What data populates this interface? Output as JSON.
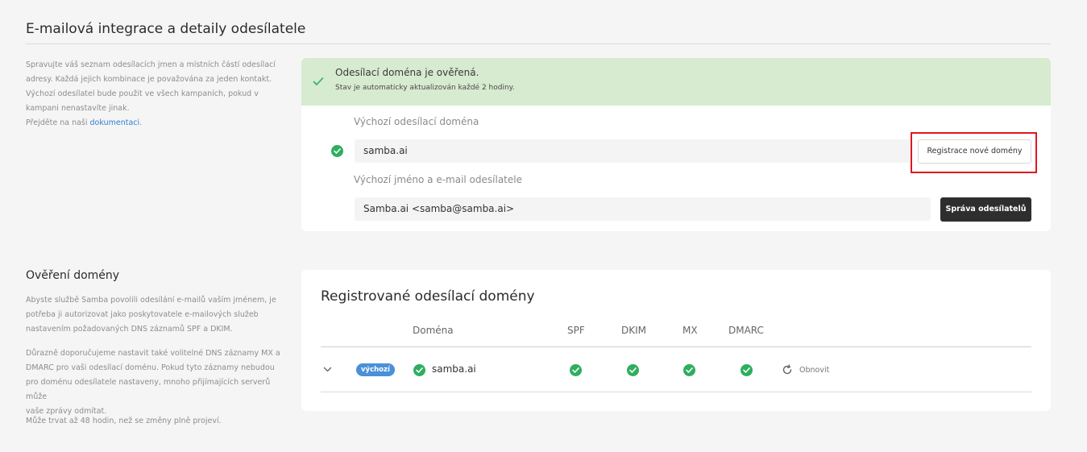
{
  "integration": {
    "title": "E-mailová integrace a detaily odesílatele",
    "description_lines": [
      "Spravujte váš seznam odesílacích jmen a místních částí odesílací",
      "adresy. Každá jejich kombinace je považována za jeden kontakt.",
      "Výchozí odesílatel bude použit ve všech kampaních, pokud v",
      "kampani nenastavíte jinak."
    ],
    "docs_prefix": "Přejděte na naši ",
    "docs_link": "dokumentaci",
    "docs_suffix": ".",
    "banner": {
      "title": "Odesílací doména je ověřená.",
      "subtitle": "Stav je automaticky aktualizován každé 2 hodiny."
    },
    "default_domain_label": "Výchozí odesílací doména",
    "default_domain_value": "samba.ai",
    "register_button": "Registrace nové domény",
    "default_sender_label": "Výchozí jméno a e-mail odesílatele",
    "default_sender_value": "Samba.ai <samba@samba.ai>",
    "manage_senders_button": "Správa odesílatelů"
  },
  "verification": {
    "title": "Ověření domény",
    "paragraph1_lines": [
      "Abyste službě Samba povolili odesílání e-mailů vaším jménem, je",
      "potřeba ji autorizovat jako poskytovatele e-mailových služeb",
      "nastavením požadovaných DNS záznamů SPF a DKIM."
    ],
    "paragraph2_lines": [
      "Důrazně doporučujeme nastavit také volitelné DNS záznamy MX a",
      "DMARC pro vaši odesílací doménu. Pokud tyto záznamy nebudou",
      "pro doménu odesílatele nastaveny, mnoho přijímajících serverů může",
      "vaše zprávy odmítat."
    ],
    "paragraph3": "Může trvat až 48 hodin, než se změny plně projeví."
  },
  "domains_table": {
    "title": "Registrované odesílací domény",
    "headers": {
      "domain": "Doména",
      "spf": "SPF",
      "dkim": "DKIM",
      "mx": "MX",
      "dmarc": "DMARC"
    },
    "rows": [
      {
        "badge": "výchozí",
        "domain": "samba.ai",
        "spf": "ok",
        "dkim": "ok",
        "mx": "ok",
        "dmarc": "ok",
        "refresh_label": "Obnovit"
      }
    ]
  },
  "colors": {
    "success": "#2fae5f",
    "banner": "#d6ebcf",
    "link": "#2f7fd1",
    "badge": "#4a90d9",
    "highlight": "#e0161f",
    "dark_button": "#2e2e2e"
  },
  "icons": [
    "check-icon",
    "check-circle-icon",
    "chevron-down-icon",
    "refresh-icon"
  ]
}
